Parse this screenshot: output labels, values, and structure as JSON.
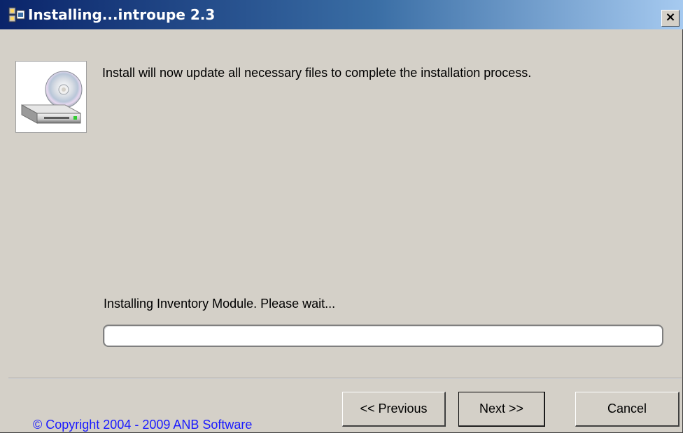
{
  "window": {
    "title": "Installing...introupe 2.3",
    "close_label": "×"
  },
  "icons": {
    "title_icon": "installer-icon",
    "disk_icon": "cd-drive-icon",
    "close_icon": "close-icon"
  },
  "main": {
    "intro_text": "Install will now update all necessary files to complete the installation process.",
    "status_text": "Installing Inventory Module.  Please wait...",
    "progress_fraction": 0.0
  },
  "footer": {
    "copyright": "© Copyright 2004 - 2009 ANB Software",
    "previous_label": "<< Previous",
    "next_label": "Next >>",
    "cancel_label": "Cancel"
  },
  "colors": {
    "titlebar_start": "#0a246a",
    "titlebar_end": "#a6caf0",
    "copyright_link": "#1a1aff",
    "dialog_bg": "#d4d0c8"
  }
}
